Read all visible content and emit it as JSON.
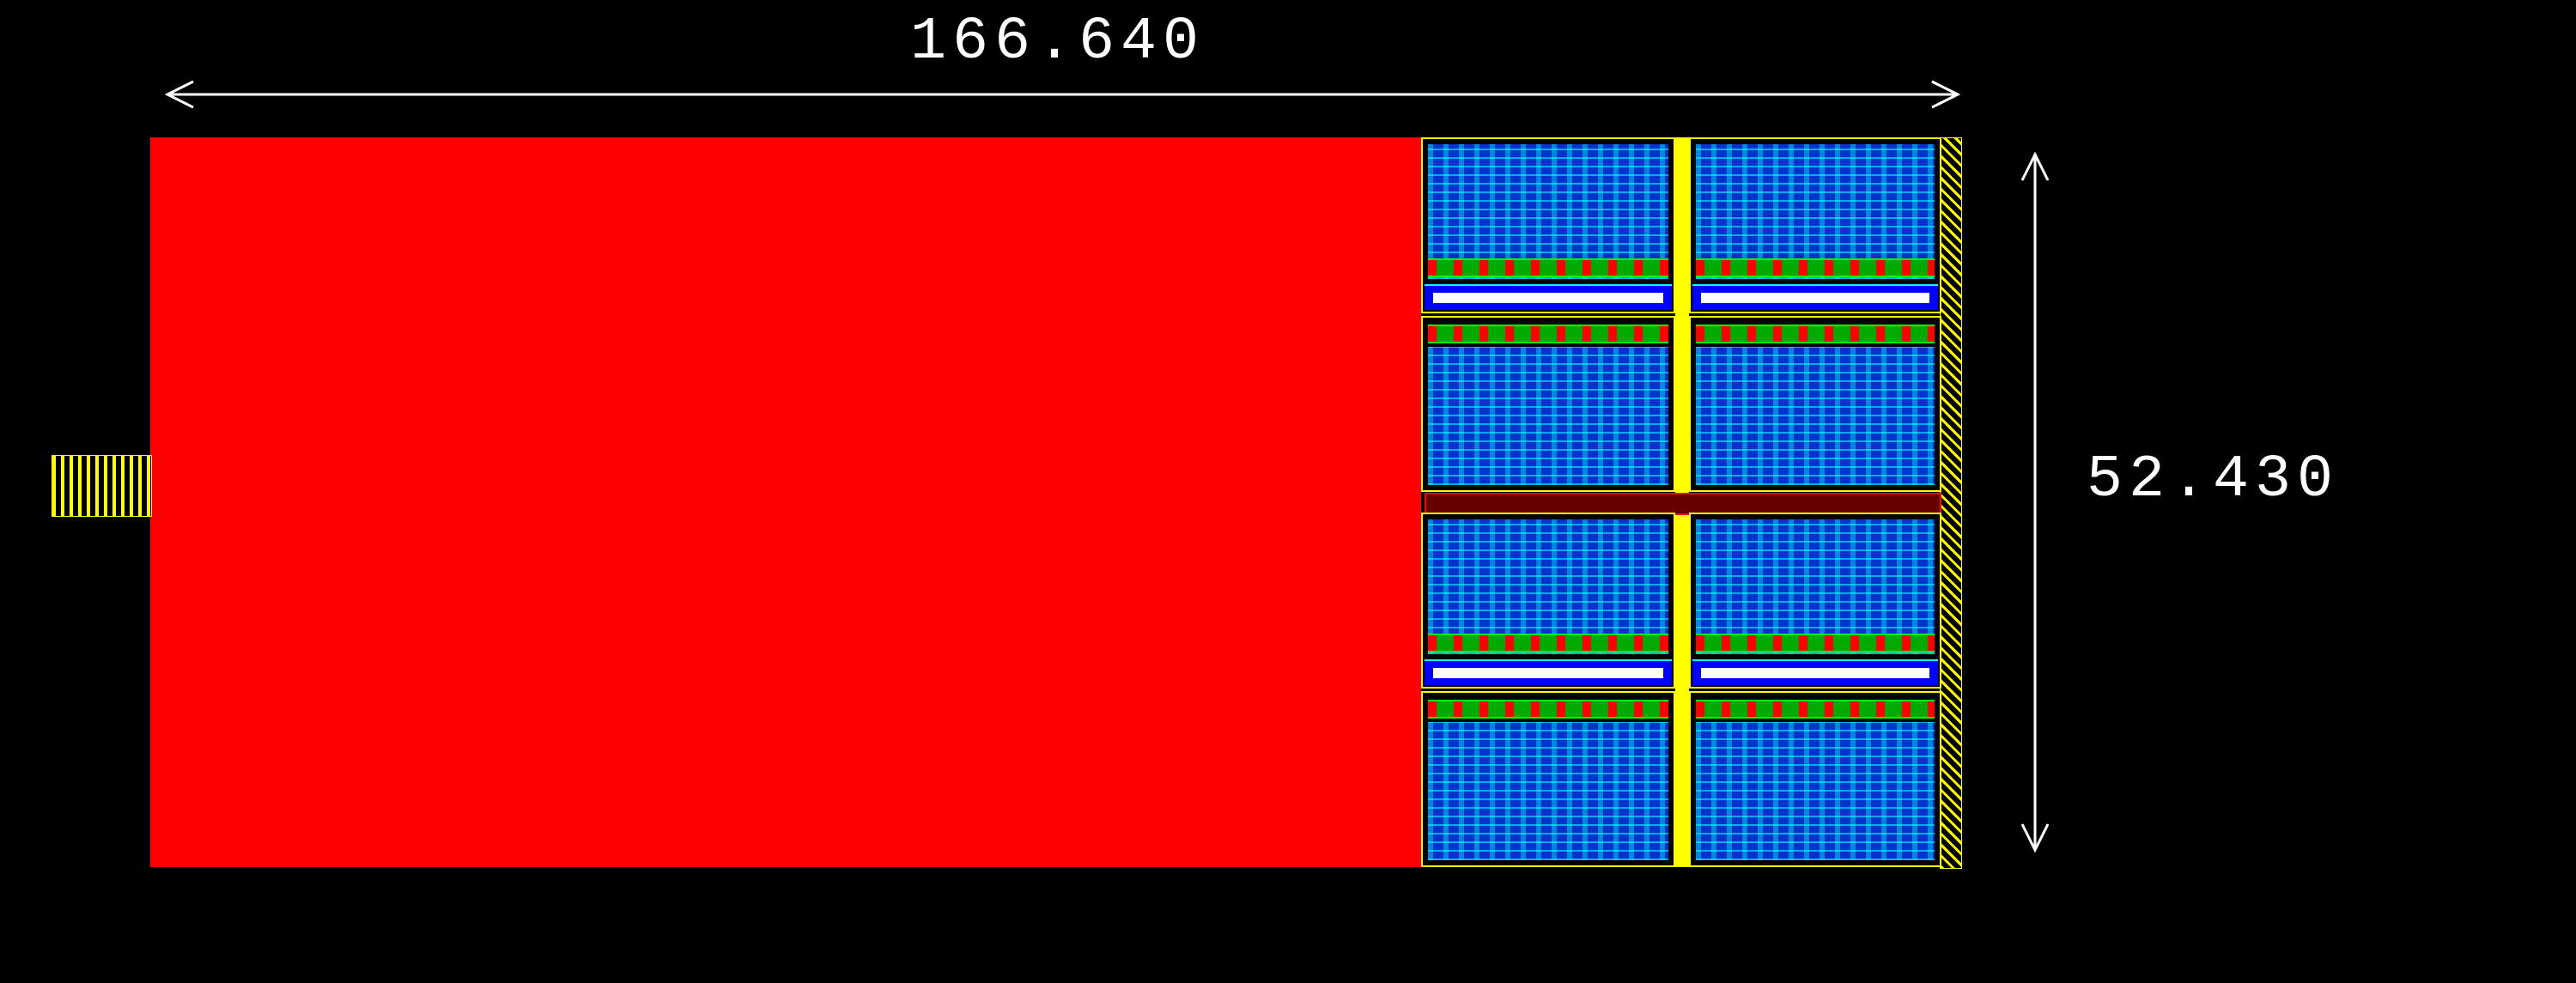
{
  "dimensions": {
    "width_label": "166.640",
    "height_label": "52.430",
    "width_value": 166.64,
    "height_value": 52.43,
    "units": "unspecified"
  },
  "blocks": {
    "main_metal": {
      "color": "#ff0000",
      "description": "large solid red layer block"
    },
    "pin_left": {
      "color": "#ffff00",
      "description": "yellow hatched pin on left edge"
    }
  },
  "cell_array": {
    "rows": 2,
    "cols": 2,
    "sub_rows_per_cell": 2,
    "cell_fill_color": "#0033cc",
    "cell_outline_color": "#ffff00",
    "rail_color": "#0000ff",
    "rail_inner_color": "#ffffff",
    "active_strip_color": "#00aa00",
    "accent_color": "#ff0000",
    "center_gap_bar_color": "#660000",
    "right_edge_stripe": "#ffff00"
  },
  "colors": {
    "background": "#000000",
    "text": "#ffffff"
  }
}
